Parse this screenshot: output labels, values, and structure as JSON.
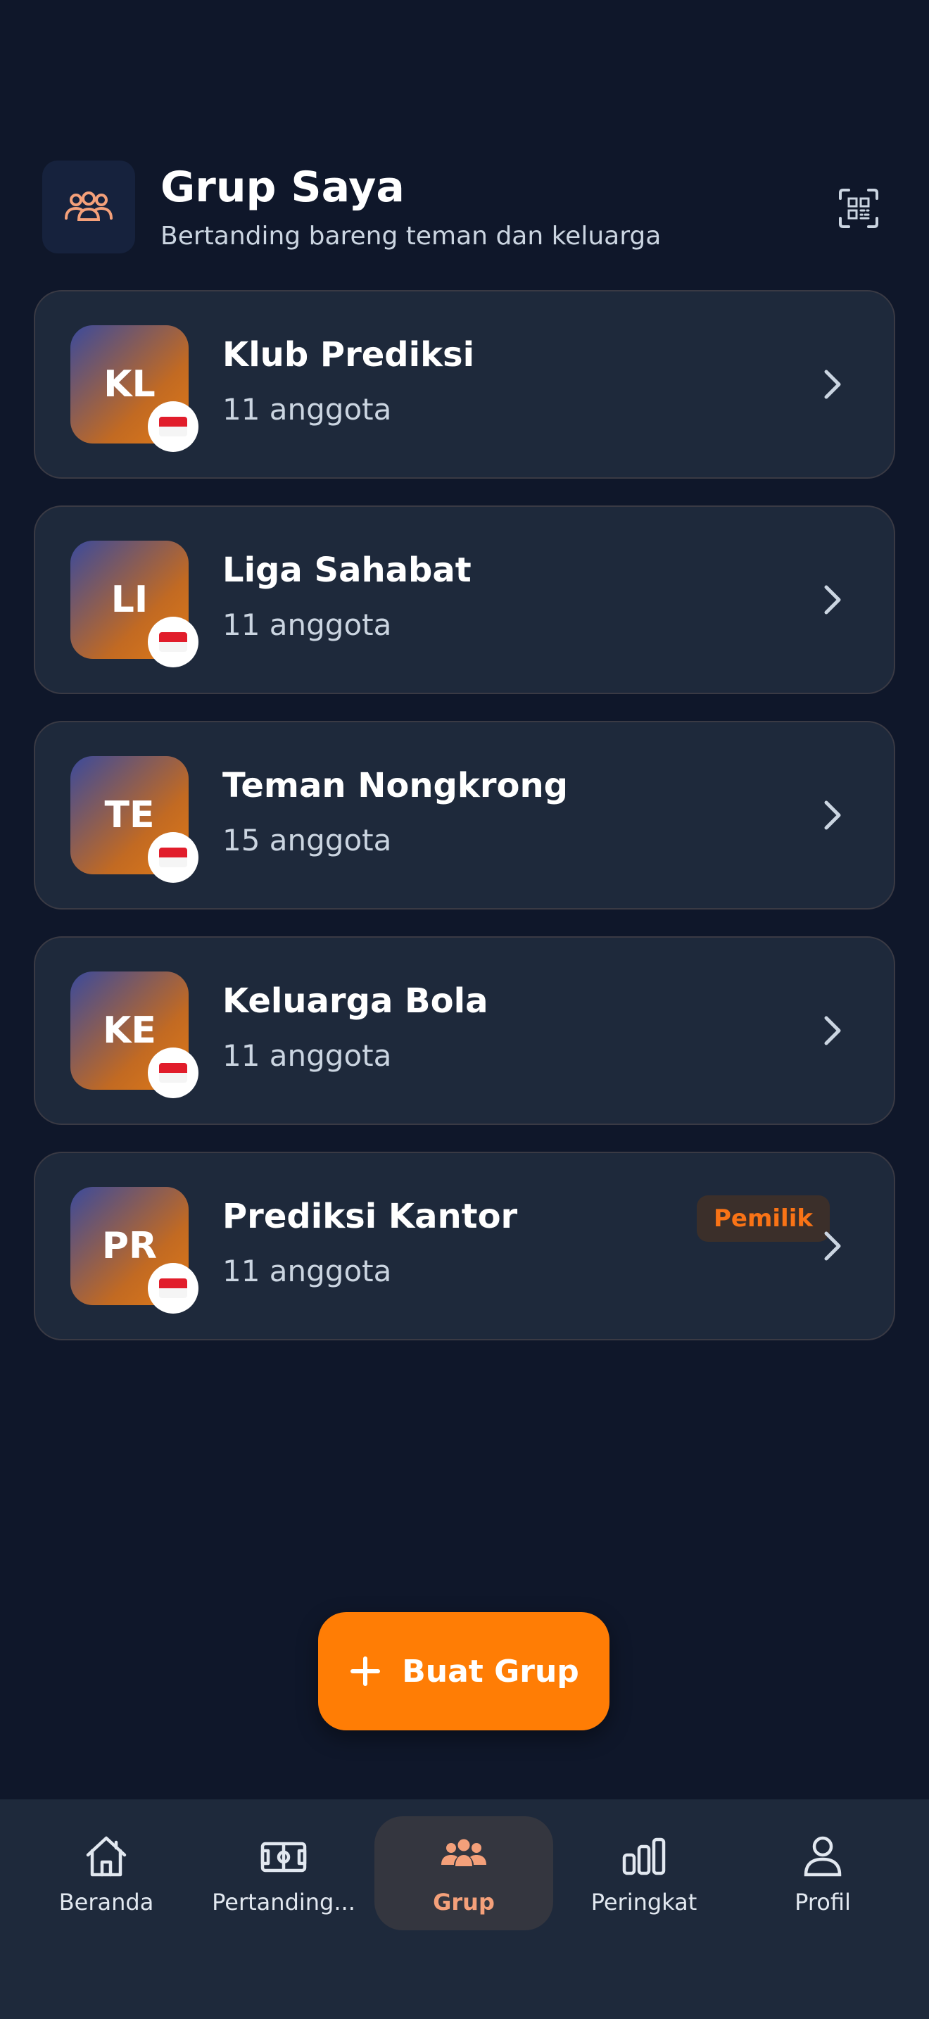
{
  "header": {
    "icon": "users-group-icon",
    "title": "Grup Saya",
    "subtitle": "Bertanding bareng teman dan keluarga",
    "qr_icon": "qr-scan-icon"
  },
  "groups": [
    {
      "initials": "KL",
      "name": "Klub Prediksi",
      "members": "11 anggota",
      "flag": "indonesia-flag-icon"
    },
    {
      "initials": "LI",
      "name": "Liga Sahabat",
      "members": "11 anggota",
      "flag": "indonesia-flag-icon"
    },
    {
      "initials": "TE",
      "name": "Teman Nongkrong",
      "members": "15 anggota",
      "flag": "indonesia-flag-icon"
    },
    {
      "initials": "KE",
      "name": "Keluarga Bola",
      "members": "11 anggota",
      "flag": "indonesia-flag-icon"
    },
    {
      "initials": "PR",
      "name": "Prediksi Kantor",
      "members": "11 anggota",
      "flag": "indonesia-flag-icon",
      "badge": "Pemilik"
    }
  ],
  "create_button": {
    "label": "Buat Grup",
    "icon": "plus-icon"
  },
  "nav": {
    "items": [
      {
        "label": "Beranda",
        "icon": "home-icon"
      },
      {
        "label": "Pertanding...",
        "icon": "football-field-icon"
      },
      {
        "label": "Grup",
        "icon": "users-group-icon",
        "active": true
      },
      {
        "label": "Peringkat",
        "icon": "bar-chart-icon"
      },
      {
        "label": "Profil",
        "icon": "user-icon"
      }
    ]
  },
  "colors": {
    "background": "#0f172a",
    "card": "#1e293b",
    "accent": "#ff7d05",
    "active_nav_label": "#f4a07a"
  }
}
